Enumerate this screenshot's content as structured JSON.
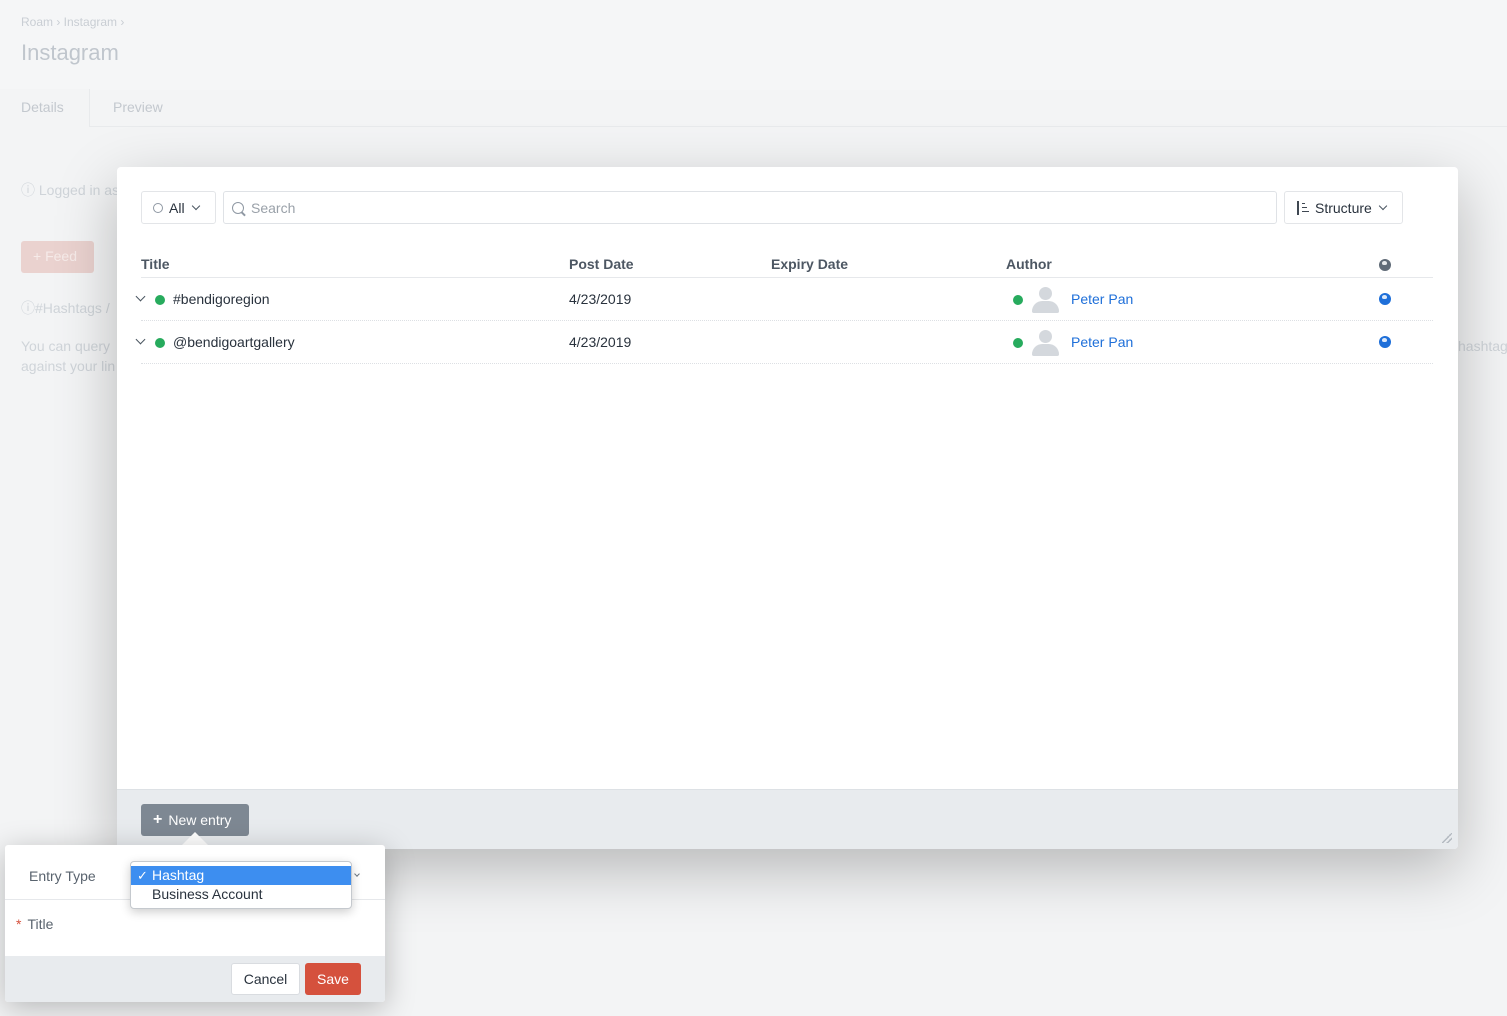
{
  "background": {
    "breadcrumb": "Roam › Instagram ›",
    "title": "Instagram",
    "tabs": [
      {
        "label": "Details"
      },
      {
        "label": "Preview"
      }
    ],
    "logged_in_text": "Logged in as",
    "feed_button": "Feed",
    "hashtags_text": "#Hashtags /",
    "info_text_line1": "You can query",
    "info_text_line2": "against your lin",
    "right_text": "hashtag"
  },
  "toolbar": {
    "status_label": "All",
    "search_placeholder": "Search",
    "structure_label": "Structure"
  },
  "table": {
    "columns": [
      "Title",
      "Post Date",
      "Expiry Date",
      "Author"
    ],
    "rows": [
      {
        "title": "#bendigoregion",
        "post_date": "4/23/2019",
        "expiry_date": "",
        "author": "Peter Pan"
      },
      {
        "title": "@bendigoartgallery",
        "post_date": "4/23/2019",
        "expiry_date": "",
        "author": "Peter Pan"
      }
    ]
  },
  "footer": {
    "new_entry_label": "New entry"
  },
  "hud": {
    "entry_type_label": "Entry Type",
    "title_label": "Title",
    "options": [
      "Hashtag",
      "Business Account"
    ],
    "selected_option": "Hashtag",
    "cancel_label": "Cancel",
    "save_label": "Save"
  },
  "colors": {
    "accent_red": "#d5513d",
    "link_blue": "#1e6fd9",
    "status_green": "#27ab5d",
    "selection_blue": "#3d8ef0"
  }
}
